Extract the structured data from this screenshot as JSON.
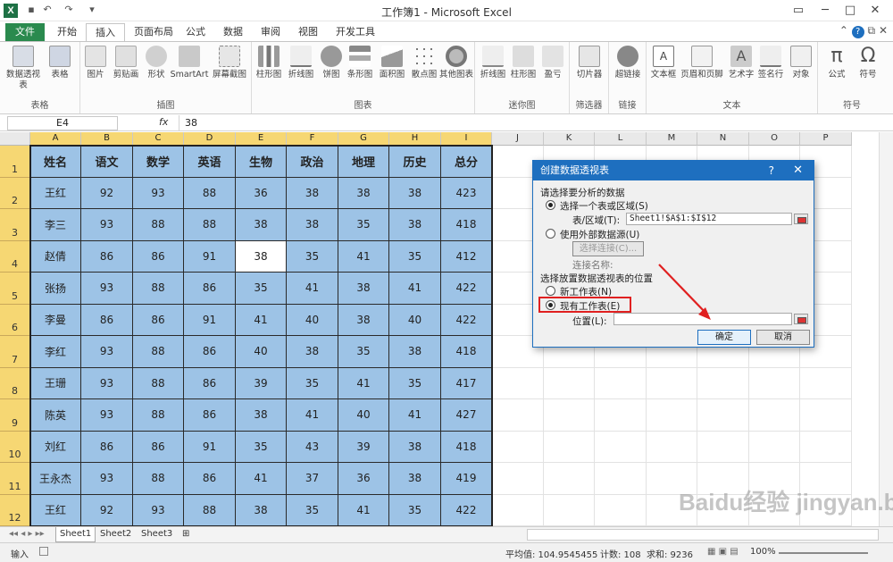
{
  "window": {
    "title": "工作簿1 - Microsoft Excel",
    "app_icon": "X"
  },
  "tabs": [
    "文件",
    "开始",
    "插入",
    "页面布局",
    "公式",
    "数据",
    "审阅",
    "视图",
    "开发工具"
  ],
  "active_tab": "插入",
  "ribbon": {
    "groups": [
      {
        "label": "表格",
        "buttons": [
          "数据透视表",
          "表格"
        ]
      },
      {
        "label": "插图",
        "buttons": [
          "图片",
          "剪贴画",
          "形状",
          "SmartArt",
          "屏幕截图"
        ]
      },
      {
        "label": "图表",
        "buttons": [
          "柱形图",
          "折线图",
          "饼图",
          "条形图",
          "面积图",
          "散点图",
          "其他图表"
        ]
      },
      {
        "label": "迷你图",
        "buttons": [
          "折线图",
          "柱形图",
          "盈亏"
        ]
      },
      {
        "label": "筛选器",
        "buttons": [
          "切片器"
        ]
      },
      {
        "label": "链接",
        "buttons": [
          "超链接"
        ]
      },
      {
        "label": "文本",
        "buttons": [
          "文本框",
          "页眉和页脚",
          "艺术字",
          "签名行",
          "对象"
        ]
      },
      {
        "label": "符号",
        "buttons": [
          "公式",
          "符号"
        ]
      }
    ]
  },
  "formula_bar": {
    "name_box": "E4",
    "fx": "fx",
    "value": "38"
  },
  "columns": [
    "A",
    "B",
    "C",
    "D",
    "E",
    "F",
    "G",
    "H",
    "I",
    "J",
    "K",
    "L",
    "M",
    "N",
    "O",
    "P"
  ],
  "rows": [
    "1",
    "2",
    "3",
    "4",
    "5",
    "6",
    "7",
    "8",
    "9",
    "10",
    "11",
    "12"
  ],
  "table": {
    "headers": [
      "姓名",
      "语文",
      "数学",
      "英语",
      "生物",
      "政治",
      "地理",
      "历史",
      "总分"
    ],
    "rows": [
      [
        "王红",
        "92",
        "93",
        "88",
        "36",
        "38",
        "38",
        "38",
        "423"
      ],
      [
        "李三",
        "93",
        "88",
        "88",
        "38",
        "38",
        "35",
        "38",
        "418"
      ],
      [
        "赵倩",
        "86",
        "86",
        "91",
        "38",
        "35",
        "41",
        "35",
        "412"
      ],
      [
        "张扬",
        "93",
        "88",
        "86",
        "35",
        "41",
        "38",
        "41",
        "422"
      ],
      [
        "李曼",
        "86",
        "86",
        "91",
        "41",
        "40",
        "38",
        "40",
        "422"
      ],
      [
        "李红",
        "93",
        "88",
        "86",
        "40",
        "38",
        "35",
        "38",
        "418"
      ],
      [
        "王珊",
        "93",
        "88",
        "86",
        "39",
        "35",
        "41",
        "35",
        "417"
      ],
      [
        "陈英",
        "93",
        "88",
        "86",
        "38",
        "41",
        "40",
        "41",
        "427"
      ],
      [
        "刘红",
        "86",
        "86",
        "91",
        "35",
        "43",
        "39",
        "38",
        "418"
      ],
      [
        "王永杰",
        "93",
        "88",
        "86",
        "41",
        "37",
        "36",
        "38",
        "419"
      ],
      [
        "王红",
        "92",
        "93",
        "88",
        "38",
        "35",
        "41",
        "35",
        "422"
      ]
    ]
  },
  "sheets": [
    "Sheet1",
    "Sheet2",
    "Sheet3"
  ],
  "active_sheet": "Sheet1",
  "status": {
    "mode": "输入",
    "average": "平均值: 104.9545455",
    "count": "计数: 108",
    "sum": "求和: 9236",
    "zoom": "100%"
  },
  "dialog": {
    "title": "创建数据透视表",
    "help": "?",
    "section1": "请选择要分析的数据",
    "opt_select_range": "选择一个表或区域(S)",
    "range_label": "表/区域(T):",
    "range_value": "Sheet1!$A$1:$I$12",
    "opt_external": "使用外部数据源(U)",
    "choose_connection": "选择连接(C)...",
    "connection_name": "连接名称:",
    "section2": "选择放置数据透视表的位置",
    "opt_new_sheet": "新工作表(N)",
    "opt_existing_sheet": "现有工作表(E)",
    "location_label": "位置(L):",
    "ok": "确定",
    "cancel": "取消"
  },
  "accent": {
    "file_tab": "#2a8a4e",
    "selection": "#9dc3e6",
    "header_highlight": "#f6d773",
    "dialog_title": "#1e6fbf",
    "annotation": "#e02020"
  },
  "watermark": "Baidu经验 jingyan.baidu.com"
}
